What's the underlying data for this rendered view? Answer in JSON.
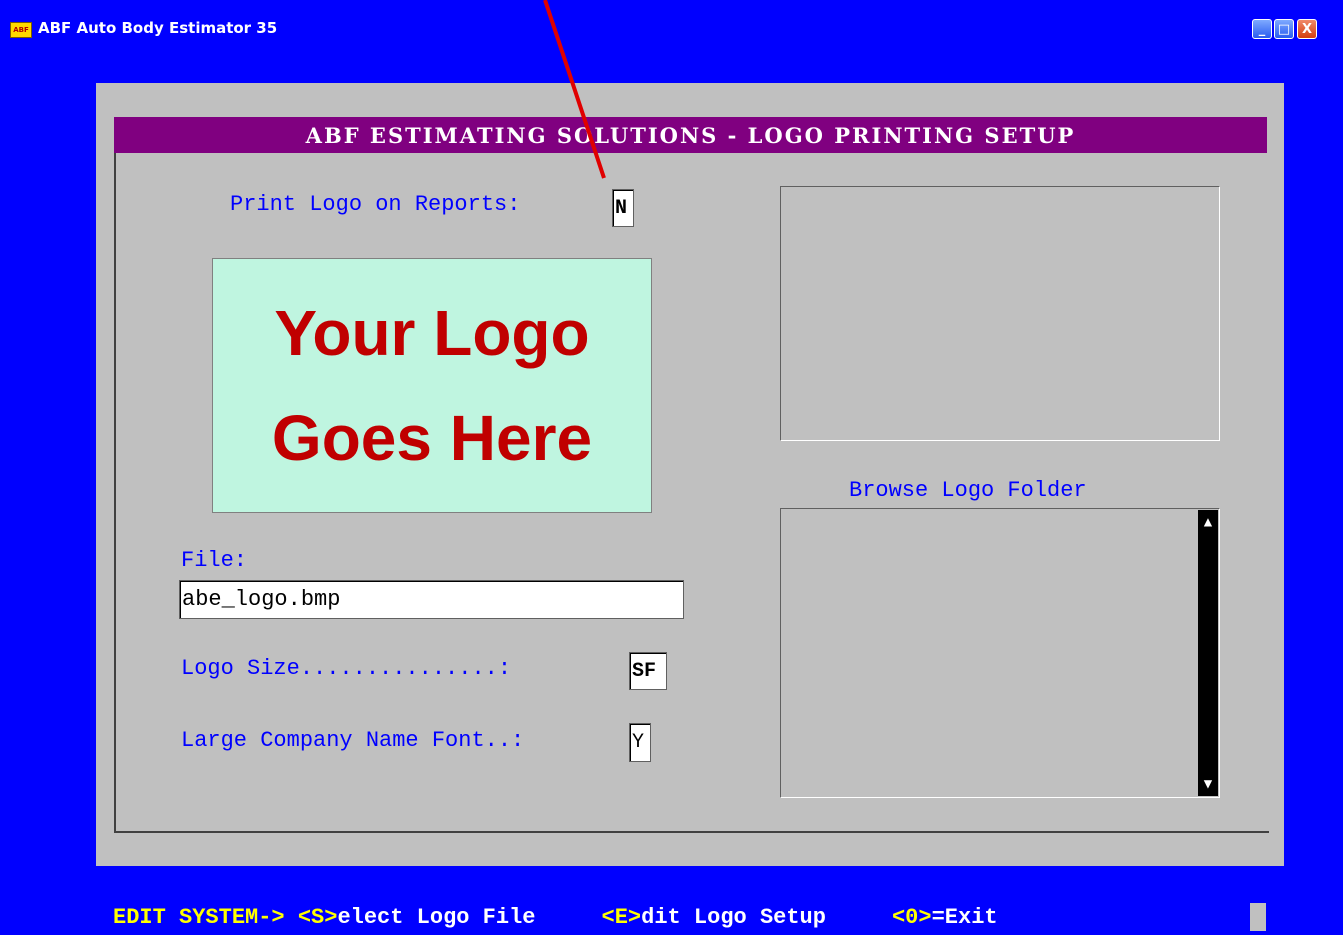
{
  "window": {
    "title": "ABF Auto Body Estimator 35",
    "icon_label": "ABF",
    "buttons": {
      "minimize": "_",
      "maximize": "□",
      "close": "X"
    }
  },
  "header": {
    "title": "ABF ESTIMATING SOLUTIONS - LOGO PRINTING SETUP"
  },
  "form": {
    "print_logo_label": "Print Logo on Reports:",
    "print_logo_value": "N",
    "logo_preview_line1": "Your Logo",
    "logo_preview_line2": "Goes Here",
    "file_label": "File:",
    "file_value": "abe_logo.bmp",
    "logo_size_label": "Logo Size...............:",
    "logo_size_value": "SF",
    "large_font_label": "Large Company Name Font..:",
    "large_font_value": "Y",
    "browse_label": "Browse Logo Folder"
  },
  "scrollbar": {
    "up": "▲",
    "down": "▼"
  },
  "footer": {
    "prefix": "EDIT SYSTEM->",
    "select_key": "<S>",
    "select_text": "elect Logo File",
    "edit_key": "<E>",
    "edit_text": "dit Logo Setup",
    "exit_key": "<0>",
    "exit_text": "=Exit"
  },
  "colors": {
    "background": "#0000ff",
    "panel": "#c0c0c0",
    "header": "#800080",
    "label": "#0000ff",
    "logo_bg": "#bff5e0",
    "logo_text": "#c00000",
    "annotation_arrow": "#e00000"
  }
}
